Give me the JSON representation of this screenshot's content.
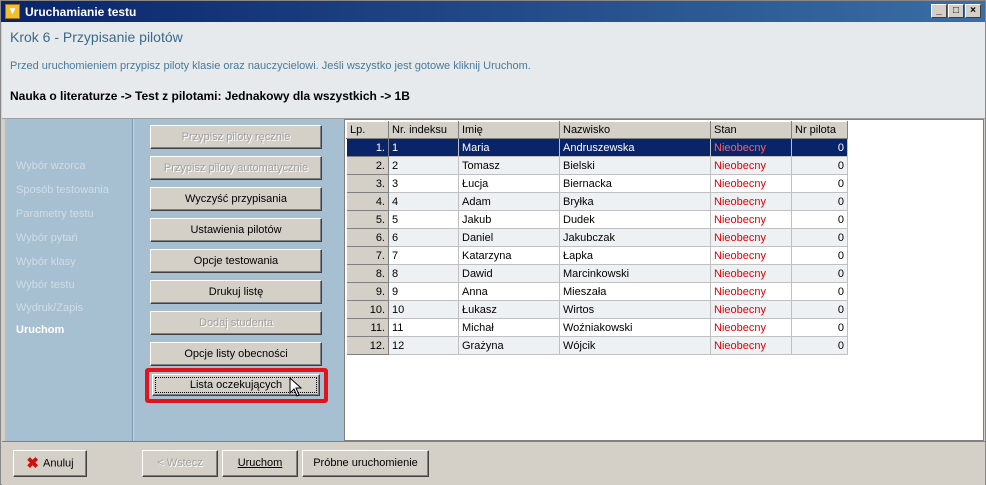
{
  "window": {
    "title": "Uruchamianie testu"
  },
  "header": {
    "step_title": "Krok 6 - Przypisanie pilotów",
    "description": "Przed uruchomieniem przypisz piloty klasie oraz nauczycielowi. Jeśli wszystko jest gotowe kliknij Uruchom.",
    "breadcrumb": "Nauka o literaturze -> Test z pilotami: Jednakowy dla wszystkich -> 1B"
  },
  "nav": {
    "items": [
      {
        "label": "Wybór wzorca",
        "active": false
      },
      {
        "label": "Sposób testowania",
        "active": false
      },
      {
        "label": "Parametry testu",
        "active": false
      },
      {
        "label": "Wybór pytań",
        "active": false
      },
      {
        "label": "Wybór klasy",
        "active": false
      },
      {
        "label": "Wybór testu",
        "active": false
      },
      {
        "label": "Wydruk/Zapis",
        "active": false
      },
      {
        "label": "Uruchom",
        "active": true
      }
    ]
  },
  "actions": {
    "assign_manual": "Przypisz piloty ręcznie",
    "assign_auto": "Przypisz piloty automatycznie",
    "clear": "Wyczyść przypisania",
    "pilot_settings": "Ustawienia pilotów",
    "test_options": "Opcje testowania",
    "print_list": "Drukuj listę",
    "add_student": "Dodaj studenta",
    "attendance_options": "Opcje listy obecności",
    "waiting_list": "Lista oczekujących"
  },
  "table": {
    "columns": [
      "Lp.",
      "Nr. indeksu",
      "Imię",
      "Nazwisko",
      "Stan",
      "Nr pilota"
    ],
    "rows": [
      [
        "1.",
        "1",
        "Maria",
        "Andruszewska",
        "Nieobecny",
        "0"
      ],
      [
        "2.",
        "2",
        "Tomasz",
        "Bielski",
        "Nieobecny",
        "0"
      ],
      [
        "3.",
        "3",
        "Łucja",
        "Biernacka",
        "Nieobecny",
        "0"
      ],
      [
        "4.",
        "4",
        "Adam",
        "Bryłka",
        "Nieobecny",
        "0"
      ],
      [
        "5.",
        "5",
        "Jakub",
        "Dudek",
        "Nieobecny",
        "0"
      ],
      [
        "6.",
        "6",
        "Daniel",
        "Jakubczak",
        "Nieobecny",
        "0"
      ],
      [
        "7.",
        "7",
        "Katarzyna",
        "Łapka",
        "Nieobecny",
        "0"
      ],
      [
        "8.",
        "8",
        "Dawid",
        "Marcinkowski",
        "Nieobecny",
        "0"
      ],
      [
        "9.",
        "9",
        "Anna",
        "Mieszała",
        "Nieobecny",
        "0"
      ],
      [
        "10.",
        "10",
        "Łukasz",
        "Wirtos",
        "Nieobecny",
        "0"
      ],
      [
        "11.",
        "11",
        "Michał",
        "Woźniakowski",
        "Nieobecny",
        "0"
      ],
      [
        "12.",
        "12",
        "Grażyna",
        "Wójcik",
        "Nieobecny",
        "0"
      ]
    ]
  },
  "footer": {
    "cancel": "Anuluj",
    "back": "< Wstecz",
    "run": "Uruchom",
    "trial_run": "Próbne uruchomienie"
  }
}
